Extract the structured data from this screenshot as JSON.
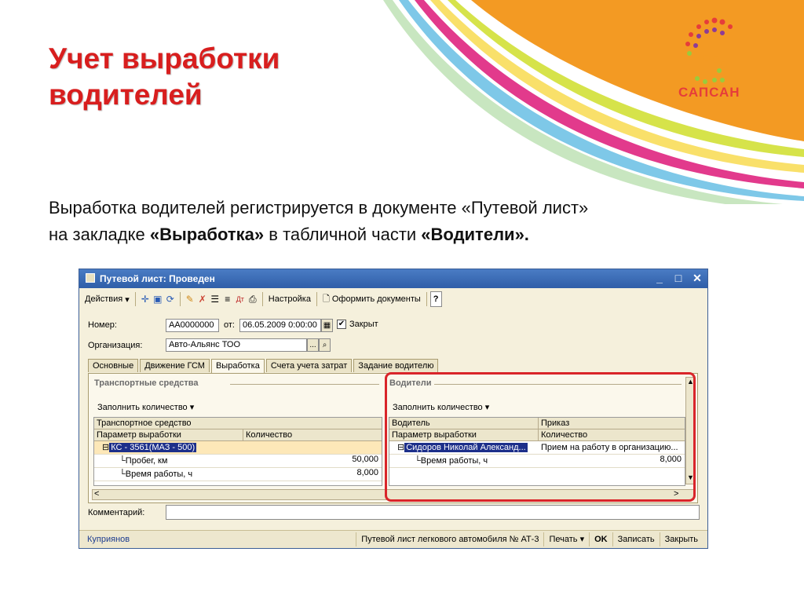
{
  "slide": {
    "title_line1": "Учет выработки",
    "title_line2": "водителей",
    "text_line1": "Выработка водителей регистрируется в документе «Путевой лист»",
    "text_line2_a": "на закладке ",
    "text_line2_b": "«Выработка»",
    "text_line2_c": " в табличной части ",
    "text_line2_d": "«Водители».",
    "logo_text": "САПСАН",
    "colors": {
      "title": "#d81e1e",
      "orange": "#f39a23",
      "logo": "#e63d3a"
    }
  },
  "window": {
    "title": "Путевой лист: Проведен",
    "controls": {
      "minimize": "_",
      "maximize": "□",
      "close": "✕"
    },
    "toolbar": {
      "actions_label": "Действия",
      "settings_label": "Настройка",
      "documents_label": "Оформить документы",
      "help_label": "?",
      "icons": [
        "move-icon",
        "copy-icon",
        "refresh-icon",
        "post-icon",
        "unpost-icon",
        "structure-icon",
        "list-icon",
        "dt-kt-icon",
        "print-icon"
      ]
    },
    "form": {
      "number_label": "Номер:",
      "number_value": "АА0000000",
      "from_label": "от:",
      "date_value": "06.05.2009 0:00:00",
      "closed_label": "Закрыт",
      "closed_checked": true,
      "org_label": "Организация:",
      "org_value": "Авто-Альянс ТОО",
      "select_button": "...",
      "search_button": "🔍"
    },
    "tabs": [
      "Основные",
      "Движение ГСМ",
      "Выработка",
      "Счета учета затрат",
      "Задание водителю"
    ],
    "active_tab": "Выработка",
    "vehicles": {
      "title": "Транспортные средства",
      "fill_label": "Заполнить количество",
      "headers": {
        "row1": "Транспортное средство",
        "col1": "Параметр выработки",
        "col2": "Количество"
      },
      "group_row": "КС - 3561(МАЗ - 500)",
      "rows": [
        {
          "name": "Пробег, км",
          "qty": "50,000"
        },
        {
          "name": "Время работы, ч",
          "qty": "8,000"
        }
      ]
    },
    "drivers": {
      "title": "Водители",
      "fill_label": "Заполнить количество",
      "headers": {
        "driver": "Водитель",
        "order": "Приказ",
        "col1": "Параметр выработки",
        "col2": "Количество"
      },
      "group_driver": "Сидоров Николай Александ...",
      "group_order": "Прием на работу в организацию...",
      "rows": [
        {
          "name": "Время работы, ч",
          "qty": "8,000"
        }
      ]
    },
    "comment_label": "Комментарий:",
    "comment_value": "",
    "status": {
      "user": "Куприянов",
      "form_name": "Путевой лист легкового автомобиля № АТ-3",
      "print_label": "Печать",
      "ok_label": "OK",
      "save_label": "Записать",
      "close_label": "Закрыть"
    }
  }
}
